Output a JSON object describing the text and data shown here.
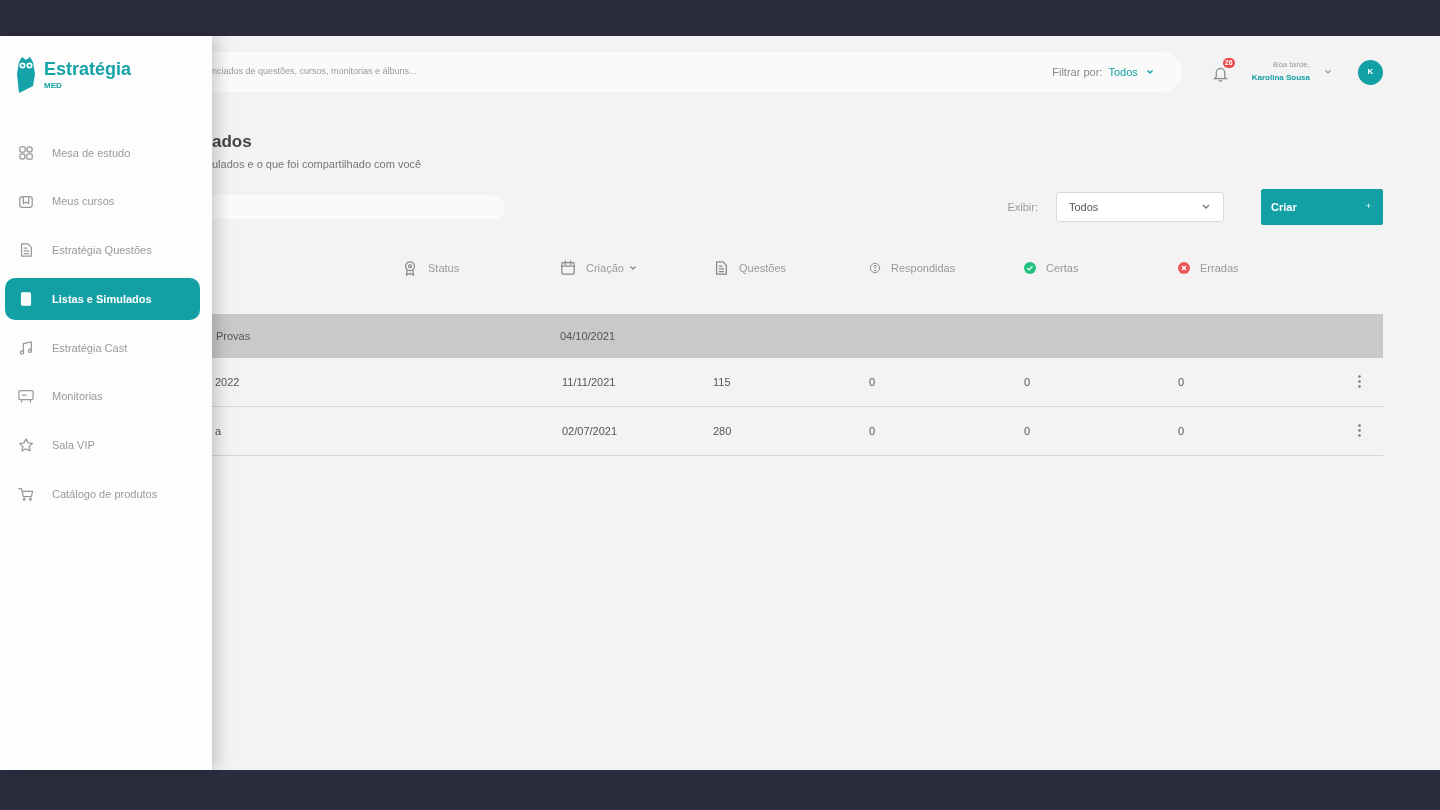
{
  "brand": {
    "name": "Estratégia",
    "sub": "MED"
  },
  "sidebar": {
    "items": [
      {
        "label": "Mesa de estudo",
        "kind": "grid",
        "selected": false
      },
      {
        "label": "Meus cursos",
        "kind": "book",
        "selected": false
      },
      {
        "label": "Estratégia Questões",
        "kind": "document",
        "selected": false
      },
      {
        "label": "Listas e Simulados",
        "kind": "list",
        "selected": true
      },
      {
        "label": "Estratégia Cast",
        "kind": "music",
        "selected": false
      },
      {
        "label": "Monitorias",
        "kind": "board",
        "selected": false
      },
      {
        "label": "Sala VIP",
        "kind": "star",
        "selected": false
      },
      {
        "label": "Catálogo de produtos",
        "kind": "cart",
        "selected": false
      }
    ]
  },
  "search": {
    "placeholder": "nciados de questões, cursos, monitorias e álbuns..."
  },
  "filter": {
    "label": "Filtrar por:",
    "value": "Todos"
  },
  "notifications": {
    "count": "26"
  },
  "user": {
    "greeting": "Boa tarde,",
    "name": "Karolina Sousa",
    "initial": "K"
  },
  "page": {
    "title": "ados",
    "subtitle": "ulados e o que foi compartilhado com você"
  },
  "display": {
    "label": "Exibir:",
    "value": "Todos"
  },
  "create_button": {
    "label": "Criar",
    "icon": "+"
  },
  "table": {
    "columns": [
      {
        "label": "Status",
        "kind": "award",
        "sorted": false
      },
      {
        "label": "Criação",
        "kind": "calendar",
        "sorted": true
      },
      {
        "label": "Questões",
        "kind": "document",
        "sorted": false
      },
      {
        "label": "Respondidas",
        "kind": "question",
        "sorted": false
      },
      {
        "label": "Certas",
        "kind": "check",
        "sorted": false
      },
      {
        "label": "Erradas",
        "kind": "cross",
        "sorted": false
      }
    ],
    "group_row": {
      "name": "Provas",
      "created": "04/10/2021"
    },
    "rows": [
      {
        "name": "2022",
        "created": "11/11/2021",
        "questions": "115",
        "answered": "0",
        "correct": "0",
        "wrong": "0"
      },
      {
        "name": "a",
        "created": "02/07/2021",
        "questions": "280",
        "answered": "0",
        "correct": "0",
        "wrong": "0"
      }
    ]
  }
}
